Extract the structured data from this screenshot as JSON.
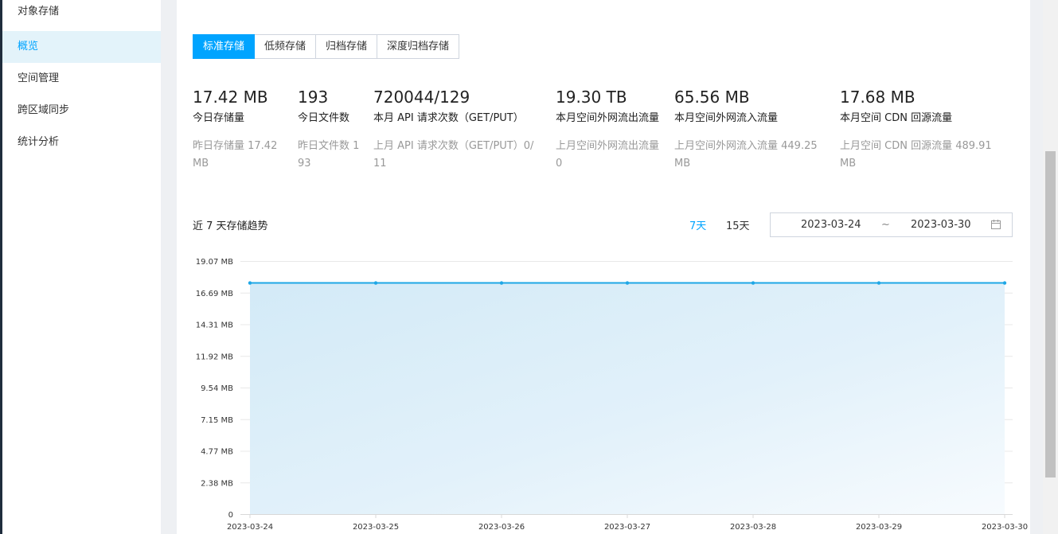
{
  "sidebar": {
    "items": [
      {
        "label": "对象存储"
      },
      {
        "label": "概览"
      },
      {
        "label": "空间管理"
      },
      {
        "label": "跨区域同步"
      },
      {
        "label": "统计分析"
      }
    ]
  },
  "tabs": [
    {
      "label": "标准存储"
    },
    {
      "label": "低频存储"
    },
    {
      "label": "归档存储"
    },
    {
      "label": "深度归档存储"
    }
  ],
  "stats": [
    {
      "value": "17.42 MB",
      "label": "今日存储量",
      "prev": "昨日存储量 17.42 MB"
    },
    {
      "value": "193",
      "label": "今日文件数",
      "prev": "昨日文件数 193"
    },
    {
      "value": "720044/129",
      "label": "本月 API 请求次数（GET/PUT）",
      "prev": "上月 API 请求次数（GET/PUT）0/11"
    },
    {
      "value": "19.30 TB",
      "label": "本月空间外网流出流量",
      "prev": "上月空间外网流出流量 0"
    },
    {
      "value": "65.56 MB",
      "label": "本月空间外网流入流量",
      "prev": "上月空间外网流入流量 449.25 MB"
    },
    {
      "value": "17.68 MB",
      "label": "本月空间 CDN 回源流量",
      "prev": "上月空间 CDN 回源流量 489.91 MB"
    }
  ],
  "trend": {
    "title": "近 7 天存储趋势",
    "range_7": "7天",
    "range_15": "15天",
    "start_date": "2023-03-24",
    "separator": "~",
    "end_date": "2023-03-30"
  },
  "colors": {
    "accent": "#00a4ff",
    "line": "#1ea7e6",
    "area": "#d6ecf8"
  },
  "chart_data": {
    "type": "area",
    "x": [
      "2023-03-24",
      "2023-03-25",
      "2023-03-26",
      "2023-03-27",
      "2023-03-28",
      "2023-03-29",
      "2023-03-30"
    ],
    "values": [
      17.42,
      17.42,
      17.42,
      17.42,
      17.42,
      17.42,
      17.42
    ],
    "ytick_labels": [
      "0",
      "2.38 MB",
      "4.77 MB",
      "7.15 MB",
      "9.54 MB",
      "11.92 MB",
      "14.31 MB",
      "16.69 MB",
      "19.07 MB"
    ],
    "ylim": [
      0,
      19.07
    ],
    "grid": true
  }
}
